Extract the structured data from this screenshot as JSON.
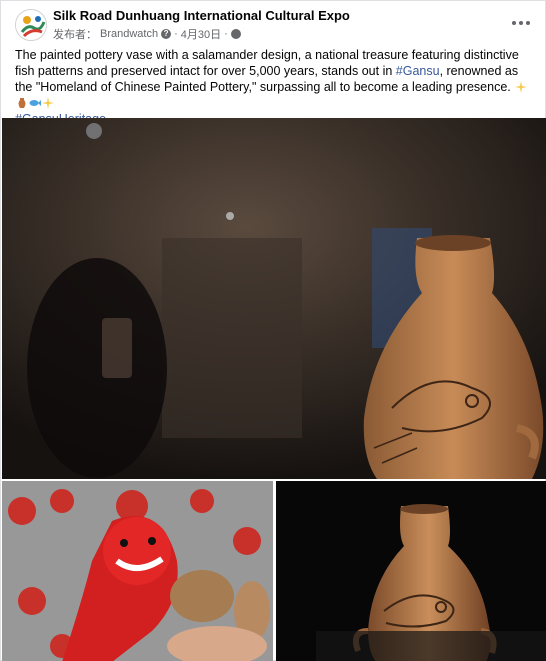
{
  "post": {
    "page_name": "Silk Road Dunhuang International Cultural Expo",
    "publisher_label": "发布者：",
    "publisher": "Brandwatch",
    "date": "4月30日",
    "separator": "·",
    "text_part1": "The painted pottery vase with a salamander design, a national treasure featuring distinctive fish patterns and preserved intact for over 5,000 years, stands out in ",
    "hashtag1": "#Gansu",
    "text_part2": ", renowned as the \"Homeland of Chinese Painted Pottery,\" surpassing all to become a leading presence. ",
    "emojis": [
      "sparkles-emoji",
      "amphora-emoji",
      "fish-emoji",
      "sparkles-emoji"
    ],
    "hashtag2": "#GansuHeritage"
  },
  "images": {
    "main": "pottery-vase-photo-with-visitor-reflection",
    "bottom_left": "red-plush-mascot-photo",
    "bottom_right": "pottery-vase-closeup-photo"
  },
  "colors": {
    "text": "#050505",
    "secondary": "#65676b",
    "link": "#385898",
    "border": "#dddfe2"
  }
}
